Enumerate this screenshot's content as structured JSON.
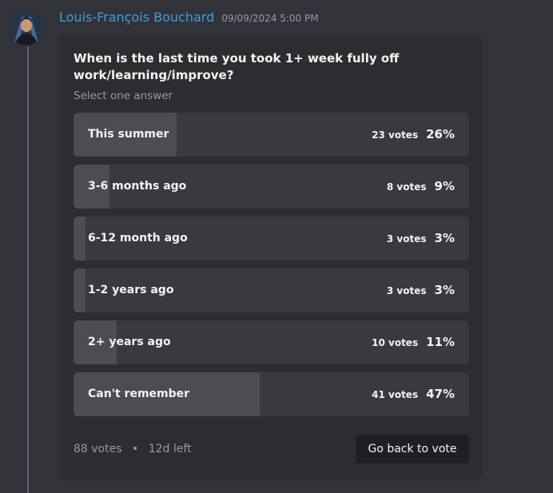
{
  "message": {
    "author": "Louis-François Bouchard",
    "timestamp": "09/09/2024 5:00 PM",
    "author_color": "#3f9be0"
  },
  "poll": {
    "question": "When is the last time you took 1+ week fully off work/learning/improve?",
    "instruction": "Select one answer",
    "answers": [
      {
        "label": "This summer",
        "votes": "23 votes",
        "percent": "26%",
        "share": 0.26
      },
      {
        "label": "3-6 months ago",
        "votes": "8 votes",
        "percent": "9%",
        "share": 0.09
      },
      {
        "label": "6-12 month ago",
        "votes": "3 votes",
        "percent": "3%",
        "share": 0.03
      },
      {
        "label": "1-2 years ago",
        "votes": "3 votes",
        "percent": "3%",
        "share": 0.03
      },
      {
        "label": "2+ years ago",
        "votes": "10 votes",
        "percent": "11%",
        "share": 0.11
      },
      {
        "label": "Can't remember",
        "votes": "41 votes",
        "percent": "47%",
        "share": 0.47
      }
    ],
    "total_votes": "88 votes",
    "time_left": "12d left",
    "separator": "•",
    "back_button_label": "Go back to vote"
  }
}
